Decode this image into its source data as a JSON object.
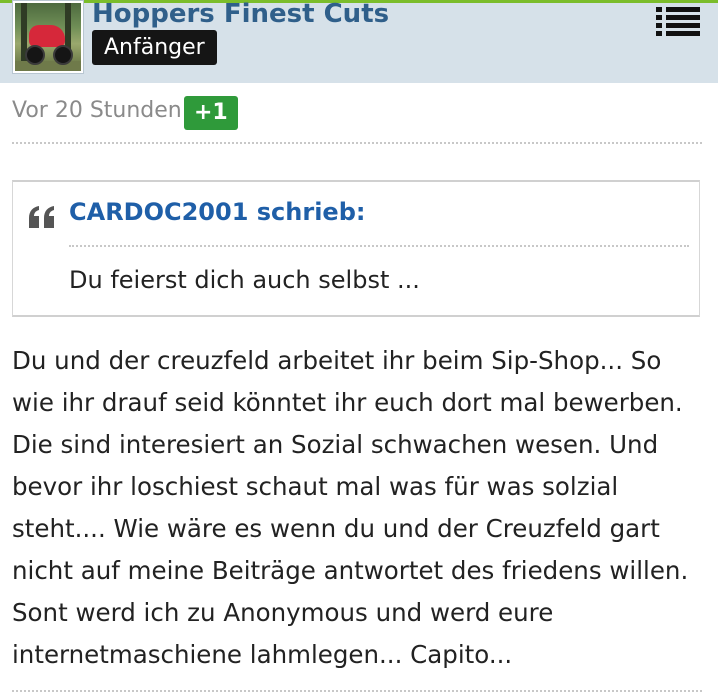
{
  "header": {
    "username": "Hoppers Finest Cuts",
    "rank": "Anfänger",
    "accent_color": "#7bbd2b",
    "background_color": "#d6e1e9",
    "menu_icon": "list-menu-icon",
    "avatar_icon": "avatar-scooter"
  },
  "meta": {
    "time": "Vor 20 Stunden",
    "reputation": "+1",
    "reputation_color": "#2f9a3a"
  },
  "quote": {
    "icon": "quote-icon",
    "citation": "CARDOC2001 schrieb:",
    "text": "Du feierst dich auch selbst ..."
  },
  "post": {
    "lines": [
      "Du und der creuzfeld arbeitet ihr beim Sip-Shop... So",
      "wie ihr drauf seid könntet ihr euch dort mal bewerben.",
      "Die sind interesiert an Sozial schwachen wesen. Und",
      "bevor ihr loschiest schaut mal was für was solzial",
      "steht.... Wie wäre es wenn du und der Creuzfeld gart",
      "nicht auf meine Beiträge antwortet des friedens willen.",
      "Sont werd ich zu Anonymous und werd eure",
      "internetmaschiene lahmlegen... Capito..."
    ]
  }
}
